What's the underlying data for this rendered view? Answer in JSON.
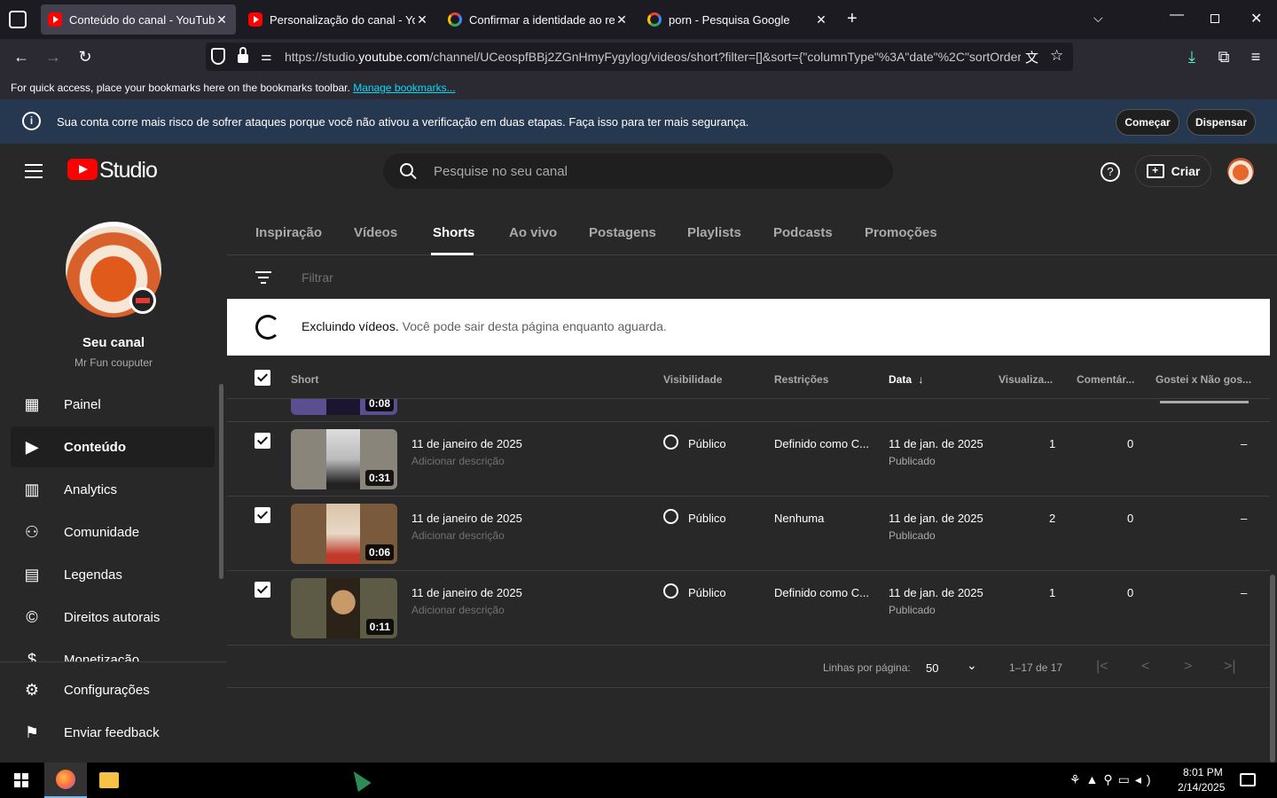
{
  "browser": {
    "tabs": [
      {
        "title": "Conteúdo do canal - YouTube S",
        "favicon": "youtube-icon",
        "active": true
      },
      {
        "title": "Personalização do canal - YouTu",
        "favicon": "youtube-icon",
        "active": false
      },
      {
        "title": "Confirmar a identidade ao realiz",
        "favicon": "google-icon",
        "active": false
      },
      {
        "title": "porn - Pesquisa Google",
        "favicon": "google-icon",
        "active": false
      }
    ],
    "url_prefix": "https://studio.",
    "url_domain": "youtube.com",
    "url_rest": "/channel/UCeospfBBj2ZGnHmyFygylog/videos/short?filter=[]&sort={\"columnType\"%3A\"date\"%2C\"sortOrder",
    "bookmarks_text": "For quick access, place your bookmarks here on the bookmarks toolbar.",
    "bookmarks_link": "Manage bookmarks..."
  },
  "banner": {
    "text": "Sua conta corre mais risco de sofrer ataques porque você não ativou a verificação em duas etapas. Faça isso para ter mais segurança.",
    "start_label": "Começar",
    "dismiss_label": "Dispensar"
  },
  "header": {
    "logo_text": "Studio",
    "search_placeholder": "Pesquise no seu canal",
    "create_label": "Criar"
  },
  "sidebar": {
    "channel_label": "Seu canal",
    "channel_name": "Mr Fun couputer",
    "items": [
      {
        "label": "Painel",
        "icon": "dashboard-icon"
      },
      {
        "label": "Conteúdo",
        "icon": "content-icon",
        "active": true
      },
      {
        "label": "Analytics",
        "icon": "analytics-icon"
      },
      {
        "label": "Comunidade",
        "icon": "community-icon"
      },
      {
        "label": "Legendas",
        "icon": "subtitles-icon"
      },
      {
        "label": "Direitos autorais",
        "icon": "copyright-icon"
      },
      {
        "label": "Monetização",
        "icon": "monetization-icon"
      }
    ],
    "bottom_items": [
      {
        "label": "Configurações",
        "icon": "gear-icon"
      },
      {
        "label": "Enviar feedback",
        "icon": "feedback-icon"
      }
    ]
  },
  "content_tabs": [
    "Inspiração",
    "Vídeos",
    "Shorts",
    "Ao vivo",
    "Postagens",
    "Playlists",
    "Podcasts",
    "Promoções"
  ],
  "active_tab": "Shorts",
  "filter_placeholder": "Filtrar",
  "notice": {
    "bold": "Excluindo vídeos.",
    "text": "Você pode sair desta página enquanto aguarda."
  },
  "table": {
    "headers": {
      "short": "Short",
      "visibility": "Visibilidade",
      "restrictions": "Restrições",
      "date": "Data",
      "views": "Visualiza...",
      "comments": "Comentár...",
      "likes": "Gostei x Não gos..."
    },
    "partial_row_duration": "0:08",
    "rows": [
      {
        "title": "11 de janeiro de 2025",
        "desc": "Adicionar descrição",
        "duration": "0:31",
        "visibility": "Público",
        "restriction": "Definido como C...",
        "date": "11 de jan. de 2025",
        "status": "Publicado",
        "views": "1",
        "comments": "0",
        "likes": "–"
      },
      {
        "title": "11 de janeiro de 2025",
        "desc": "Adicionar descrição",
        "duration": "0:06",
        "visibility": "Público",
        "restriction": "Nenhuma",
        "date": "11 de jan. de 2025",
        "status": "Publicado",
        "views": "2",
        "comments": "0",
        "likes": "–"
      },
      {
        "title": "11 de janeiro de 2025",
        "desc": "Adicionar descrição",
        "duration": "0:11",
        "visibility": "Público",
        "restriction": "Definido como C...",
        "date": "11 de jan. de 2025",
        "status": "Publicado",
        "views": "1",
        "comments": "0",
        "likes": "–"
      }
    ]
  },
  "pager": {
    "rows_label": "Linhas por página:",
    "rows_value": "50",
    "range": "1–17 de 17"
  },
  "taskbar": {
    "time": "8:01 PM",
    "date": "2/14/2025"
  },
  "colors": {
    "accent": "#ff0000",
    "banner": "#263850",
    "surface": "#282828"
  }
}
